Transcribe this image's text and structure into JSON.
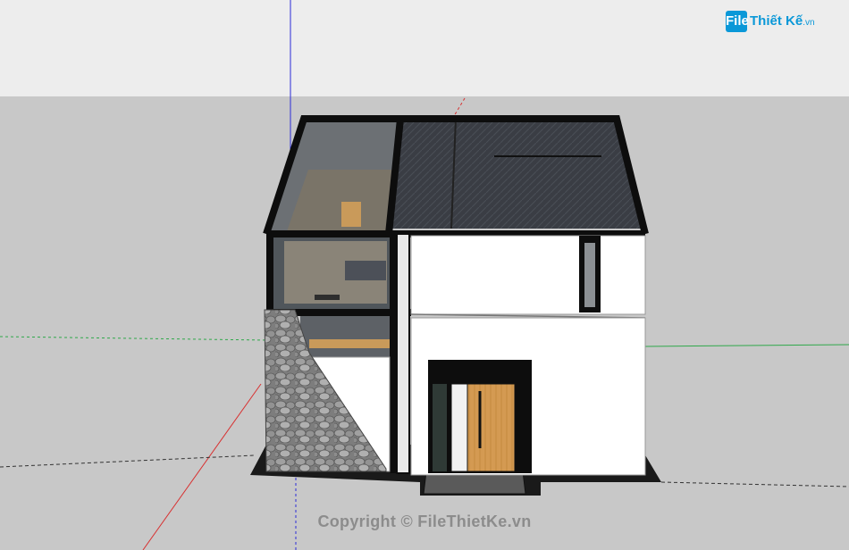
{
  "watermark": {
    "logo_letters": "File",
    "logo_name": "Thiết Kế",
    "logo_tld": ".vn",
    "copyright": "Copyright © FileThietKe.vn"
  },
  "colors": {
    "sky": "#ededed",
    "ground": "#c8c8c8",
    "frame": "#0d0d0d",
    "roof": "#3a3d44",
    "wall": "#ffffff",
    "stone": "#8a8a8a",
    "wood": "#d49a52",
    "glass": "#5a5f63",
    "axis_red": "#d83030",
    "axis_green": "#2fa84a",
    "axis_blue": "#2b2bd8",
    "logo_blue": "#0a98d8"
  },
  "icons": {
    "logo": "filethietke-logo"
  }
}
